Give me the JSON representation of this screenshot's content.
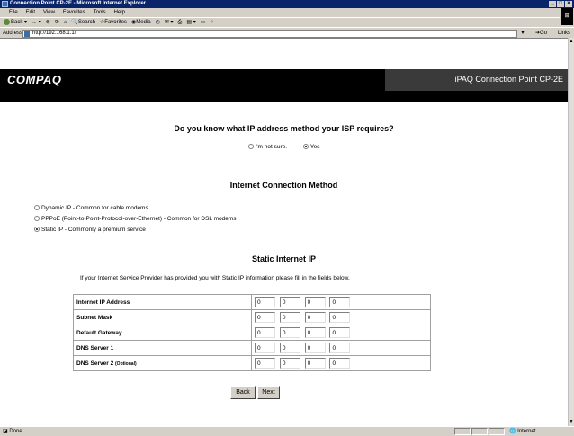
{
  "window": {
    "title": "Connection Point CP-2E - Microsoft Internet Explorer"
  },
  "menu": [
    "File",
    "Edit",
    "View",
    "Favorites",
    "Tools",
    "Help"
  ],
  "toolbar": {
    "back": "Back",
    "search": "Search",
    "favorites": "Favorites",
    "media": "Media"
  },
  "address": {
    "label": "Address",
    "url": "http://192.168.1.1/",
    "go": "Go",
    "links": "Links"
  },
  "banner": {
    "logo": "COMPAQ",
    "product": "iPAQ Connection Point CP-2E"
  },
  "isp": {
    "question": "Do you know what IP address method your ISP requires?",
    "options": [
      {
        "label": "I'm not sure.",
        "selected": false
      },
      {
        "label": "Yes",
        "selected": true
      }
    ]
  },
  "method": {
    "title": "Internet Connection Method",
    "options": [
      {
        "label": "Dynamic IP - Common for cable modems",
        "selected": false
      },
      {
        "label": "PPPoE (Point-to-Point-Protocol-over-Ethernet) - Common for DSL modems",
        "selected": false
      },
      {
        "label": "Static IP - Commonly a premium service",
        "selected": true
      }
    ]
  },
  "static": {
    "title": "Static Internet IP",
    "instruction": "If your Internet Service Provider has provided you with Static IP information please fill in the fields below.",
    "rows": [
      {
        "label": "Internet IP Address",
        "optional": "",
        "values": [
          "0",
          "0",
          "0",
          "0"
        ]
      },
      {
        "label": "Subnet Mask",
        "optional": "",
        "values": [
          "0",
          "0",
          "0",
          "0"
        ]
      },
      {
        "label": "Default Gateway",
        "optional": "",
        "values": [
          "0",
          "0",
          "0",
          "0"
        ]
      },
      {
        "label": "DNS Server 1",
        "optional": "",
        "values": [
          "0",
          "0",
          "0",
          "0"
        ]
      },
      {
        "label": "DNS Server 2",
        "optional": "(Optional)",
        "values": [
          "0",
          "0",
          "0",
          "0"
        ]
      }
    ]
  },
  "buttons": {
    "back": "Back",
    "next": "Next"
  },
  "status": {
    "text": "Done",
    "zone": "Internet"
  }
}
